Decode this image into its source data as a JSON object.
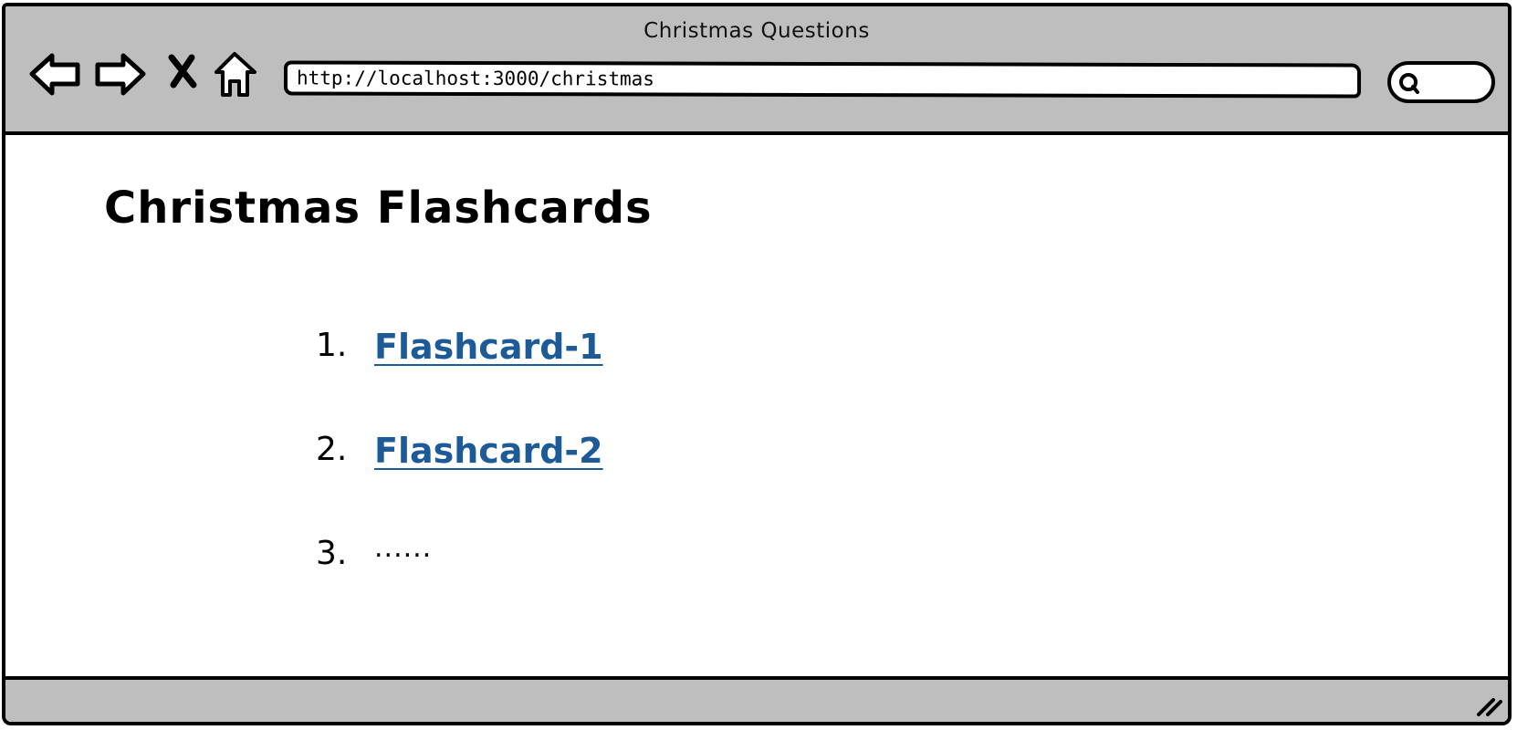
{
  "window": {
    "title": "Christmas Questions"
  },
  "toolbar": {
    "back_icon": "back-arrow-icon",
    "forward_icon": "forward-arrow-icon",
    "stop_icon": "close-x-icon",
    "home_icon": "home-icon",
    "url": "http://localhost:3000/christmas",
    "search_icon": "search-icon",
    "search_value": ""
  },
  "page": {
    "heading": "Christmas Flashcards",
    "items": [
      {
        "number": "1.",
        "label": "Flashcard-1"
      },
      {
        "number": "2.",
        "label": "Flashcard-2"
      },
      {
        "number": "3.",
        "label": "......"
      }
    ]
  },
  "colors": {
    "chrome": "#bebebe",
    "link": "#1d5a98",
    "border": "#000000"
  }
}
